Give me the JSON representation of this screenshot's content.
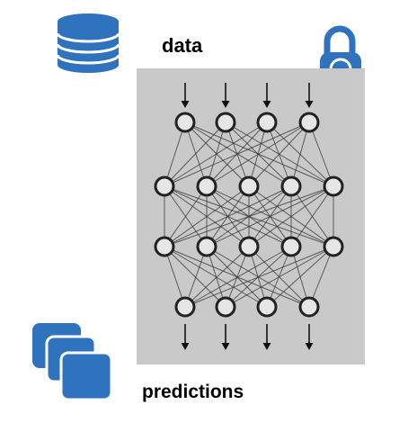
{
  "labels": {
    "input": "data",
    "output": "predictions"
  },
  "icons": {
    "input": "database-icon",
    "output": "stacked-documents-icon",
    "security": "padlock-icon"
  },
  "network": {
    "layers": [
      4,
      5,
      5,
      4
    ],
    "input_arrows": 4,
    "output_arrows": 4
  },
  "colors": {
    "icon_blue": "#2f72bd",
    "panel_gray": "#c9c9c9",
    "node_fill": "#e6e6e6",
    "node_stroke": "#222222",
    "edge_color": "#333333",
    "text": "#000000"
  }
}
